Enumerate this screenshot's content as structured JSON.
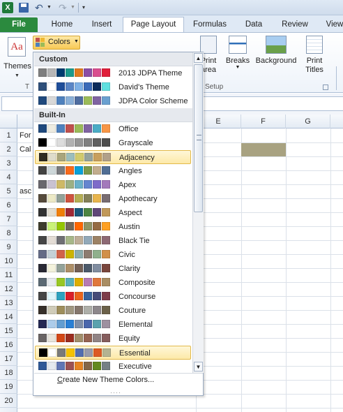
{
  "qat": {
    "app_icon": "X",
    "undo_icon": "undo-icon",
    "redo_icon": "redo-icon",
    "customize": "▾"
  },
  "tabs": [
    "File",
    "Home",
    "Insert",
    "Page Layout",
    "Formulas",
    "Data",
    "Review",
    "View"
  ],
  "ribbon": {
    "themes_label": "Themes",
    "themes_group_letter": "T",
    "colors_label": "Colors",
    "print_area_label": "Print\narea",
    "breaks_label": "Breaks",
    "background_label": "Background",
    "print_titles_label": "Print\nTitles",
    "setup_group": "Setup"
  },
  "columns": [
    "E",
    "F",
    "G"
  ],
  "rows": [
    "1",
    "2",
    "3",
    "4",
    "5",
    "6",
    "7",
    "8",
    "9",
    "10",
    "11",
    "12",
    "13",
    "14",
    "15",
    "16",
    "17",
    "18",
    "19",
    "20"
  ],
  "cells": {
    "a1": "For",
    "a2": "Cal",
    "a5": "asc"
  },
  "dropdown": {
    "custom_header": "Custom",
    "builtin_header": "Built-In",
    "custom": [
      {
        "name": "2013 JDPA Theme",
        "colors": [
          "#7f7f7f",
          "#b7b7b7",
          "#003b6f",
          "#1c9a8c",
          "#e07b20",
          "#8b4ea6",
          "#d94e8f",
          "#e01e3a"
        ]
      },
      {
        "name": "David's Theme",
        "colors": [
          "#2e4f7a",
          "#ffffff",
          "#1f4e9a",
          "#5b86c6",
          "#7fb1e6",
          "#3a6ab8",
          "#0a2a5a",
          "#5ee0e0"
        ]
      },
      {
        "name": "JDPA Color Scheme",
        "colors": [
          "#1f497d",
          "#d8d8d8",
          "#4f81bd",
          "#8bb0d8",
          "#4f6da0",
          "#9bbb59",
          "#8064a2",
          "#6aa0d0"
        ]
      }
    ],
    "builtin": [
      {
        "name": "Office",
        "colors": [
          "#1f497d",
          "#eeece1",
          "#4f81bd",
          "#c0504d",
          "#9bbb59",
          "#8064a2",
          "#4bacc6",
          "#f79646"
        ]
      },
      {
        "name": "Grayscale",
        "colors": [
          "#000000",
          "#ffffff",
          "#dddddd",
          "#b2b2b2",
          "#969696",
          "#808080",
          "#5f5f5f",
          "#4d4d4d"
        ]
      },
      {
        "name": "Adjacency",
        "colors": [
          "#2f2b20",
          "#dfdccb",
          "#a9a57c",
          "#9cbebd",
          "#d2cb6c",
          "#95a39d",
          "#c89f5d",
          "#b1a089"
        ]
      },
      {
        "name": "Angles",
        "colors": [
          "#434342",
          "#cdd7d9",
          "#797b7e",
          "#f96a1b",
          "#08a1d9",
          "#7c984a",
          "#c2ad8d",
          "#506e94"
        ]
      },
      {
        "name": "Apex",
        "colors": [
          "#69676d",
          "#c9c2d1",
          "#ceb966",
          "#9cb084",
          "#6bb1c9",
          "#6585cf",
          "#7e6bc9",
          "#a379bb"
        ]
      },
      {
        "name": "Apothecary",
        "colors": [
          "#564b3c",
          "#ece9c6",
          "#93a299",
          "#cf543f",
          "#b5ae53",
          "#848058",
          "#e8b54d",
          "#786c71"
        ]
      },
      {
        "name": "Aspect",
        "colors": [
          "#323232",
          "#e3ded1",
          "#f07f09",
          "#9f2936",
          "#1b587c",
          "#4e8542",
          "#604878",
          "#c19859"
        ]
      },
      {
        "name": "Austin",
        "colors": [
          "#3e3d2d",
          "#caf278",
          "#94c600",
          "#71685a",
          "#ff6700",
          "#909465",
          "#956b43",
          "#fea022"
        ]
      },
      {
        "name": "Black Tie",
        "colors": [
          "#464646",
          "#e3dcd5",
          "#6f6f74",
          "#a7b789",
          "#beae98",
          "#92a9b9",
          "#9c8265",
          "#8d6974"
        ]
      },
      {
        "name": "Civic",
        "colors": [
          "#646b86",
          "#c5d1d7",
          "#d16349",
          "#ccb400",
          "#8cadae",
          "#8c7b70",
          "#8fb08c",
          "#d19049"
        ]
      },
      {
        "name": "Clarity",
        "colors": [
          "#292934",
          "#f3f2dc",
          "#93a299",
          "#ad8f67",
          "#726056",
          "#4c5a6a",
          "#808da0",
          "#79463d"
        ]
      },
      {
        "name": "Composite",
        "colors": [
          "#5b6973",
          "#e7ebee",
          "#98c723",
          "#59b0b9",
          "#deae00",
          "#b77bb4",
          "#e0773c",
          "#a98d63"
        ]
      },
      {
        "name": "Concourse",
        "colors": [
          "#464646",
          "#def5fa",
          "#2da2bf",
          "#da1f28",
          "#eb641b",
          "#39639d",
          "#474b78",
          "#7d3c4a"
        ]
      },
      {
        "name": "Couture",
        "colors": [
          "#37302a",
          "#d0ccb9",
          "#9e8e5c",
          "#a09781",
          "#85776d",
          "#aeafa9",
          "#8d878b",
          "#6b6149"
        ]
      },
      {
        "name": "Elemental",
        "colors": [
          "#242852",
          "#acccea",
          "#629dd1",
          "#297fd5",
          "#7f8fa9",
          "#4a66ac",
          "#5aa2ae",
          "#9d90a0"
        ]
      },
      {
        "name": "Equity",
        "colors": [
          "#696464",
          "#e9e5dc",
          "#d34817",
          "#9b2d1f",
          "#a28e6a",
          "#956251",
          "#918485",
          "#855d5d"
        ]
      },
      {
        "name": "Essential",
        "colors": [
          "#000000",
          "#ffffff",
          "#7a7a7a",
          "#f5c201",
          "#526db0",
          "#989aac",
          "#dc5924",
          "#b4b392"
        ]
      },
      {
        "name": "Executive",
        "colors": [
          "#2f5897",
          "#e4e9ef",
          "#6076b4",
          "#9c5252",
          "#e68422",
          "#846648",
          "#63891f",
          "#758085"
        ]
      }
    ],
    "create_new": "Create New Theme Colors...",
    "create_new_mnemonic": "C",
    "grip": "····"
  }
}
